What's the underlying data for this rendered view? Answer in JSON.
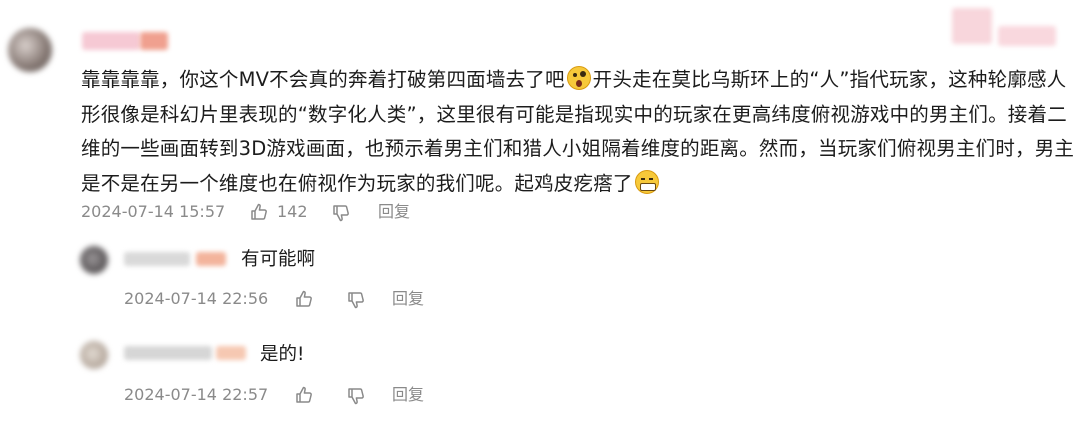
{
  "main_comment": {
    "lines": [
      [
        "靠靠靠靠，你这个MV不会真的奔着打破第四面墙去了吧",
        "开头走在莫比乌斯环上的“人”指代玩家，这种轮廓感人"
      ],
      "形很像是科幻片里表现的“数字化人类”，这里很有可能是指现实中的玩家在更高纬度俯视游戏中的男主们。接着二",
      "维的一些画面转到3D游戏画面，也预示着男主们和猎人小姐隔着维度的距离。然而，当玩家们俯视男主们时，男主",
      "是不是在另一个维度也在俯视作为玩家的我们呢。起鸡皮疙瘩了"
    ],
    "emoji_1": "shock-face-emoji",
    "emoji_2": "grimace-face-emoji",
    "timestamp": "2024-07-14 15:57",
    "like_count": "142",
    "reply_label": "回复"
  },
  "replies": [
    {
      "text": "有可能啊",
      "timestamp": "2024-07-14 22:56",
      "reply_label": "回复"
    },
    {
      "text": "是的!",
      "timestamp": "2024-07-14 22:57",
      "reply_label": "回复"
    }
  ],
  "icons": {
    "like": "thumbs-up-icon",
    "dislike": "thumbs-down-icon"
  },
  "colors": {
    "meta_text": "#8a8a8a",
    "body_text": "#1c1c1c",
    "background": "#ffffff"
  }
}
